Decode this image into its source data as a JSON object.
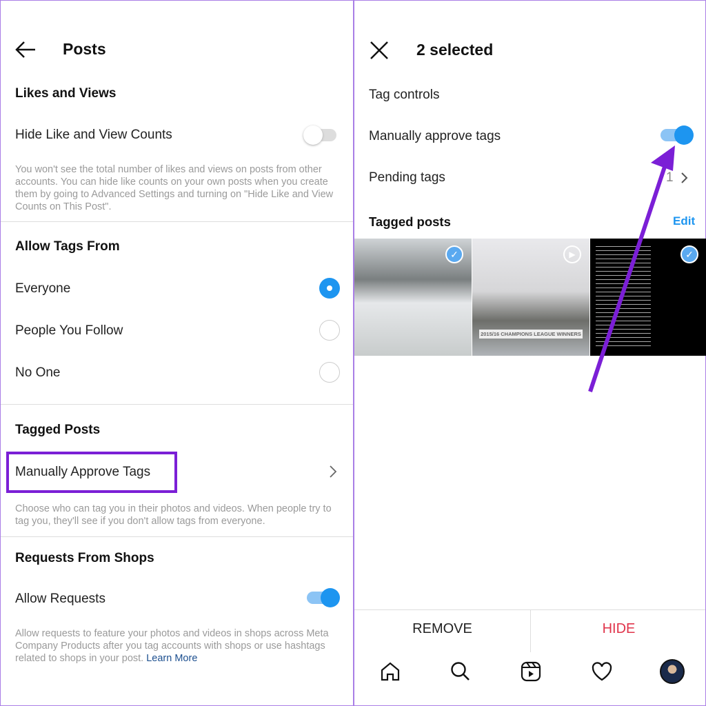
{
  "left": {
    "title": "Posts",
    "likes_header": "Likes and Views",
    "hide_counts_label": "Hide Like and View Counts",
    "hide_counts_on": false,
    "likes_desc": "You won't see the total number of likes and views on posts from other accounts. You can hide like counts on your own posts when you create them by going to Advanced Settings and turning on \"Hide Like and View Counts on This Post\".",
    "tags_header": "Allow Tags From",
    "options": [
      {
        "label": "Everyone",
        "selected": true
      },
      {
        "label": "People You Follow",
        "selected": false
      },
      {
        "label": "No One",
        "selected": false
      }
    ],
    "tagged_header": "Tagged Posts",
    "manual_label": "Manually Approve Tags",
    "tagged_desc": "Choose who can tag you in their photos and videos. When people try to tag you, they'll see if you don't allow tags from everyone.",
    "shops_header": "Requests From Shops",
    "allow_label": "Allow Requests",
    "allow_on": true,
    "shops_desc": "Allow requests to feature your photos and videos in shops across Meta Company Products after you tag accounts with shops or use hashtags related to shops in your post.",
    "learn_more": "Learn More"
  },
  "right": {
    "title": "2 selected",
    "tag_controls": "Tag controls",
    "manual_label": "Manually approve tags",
    "manual_on": true,
    "pending_label": "Pending tags",
    "pending_count": "1",
    "tagged_posts": "Tagged posts",
    "edit": "Edit",
    "thumb2_caption": "2015/16 CHAMPIONS LEAGUE WINNERS",
    "remove": "REMOVE",
    "hide": "HIDE"
  },
  "colors": {
    "accent": "#1d95f0",
    "highlight": "#7b1fd6",
    "hide": "#e0334a"
  }
}
